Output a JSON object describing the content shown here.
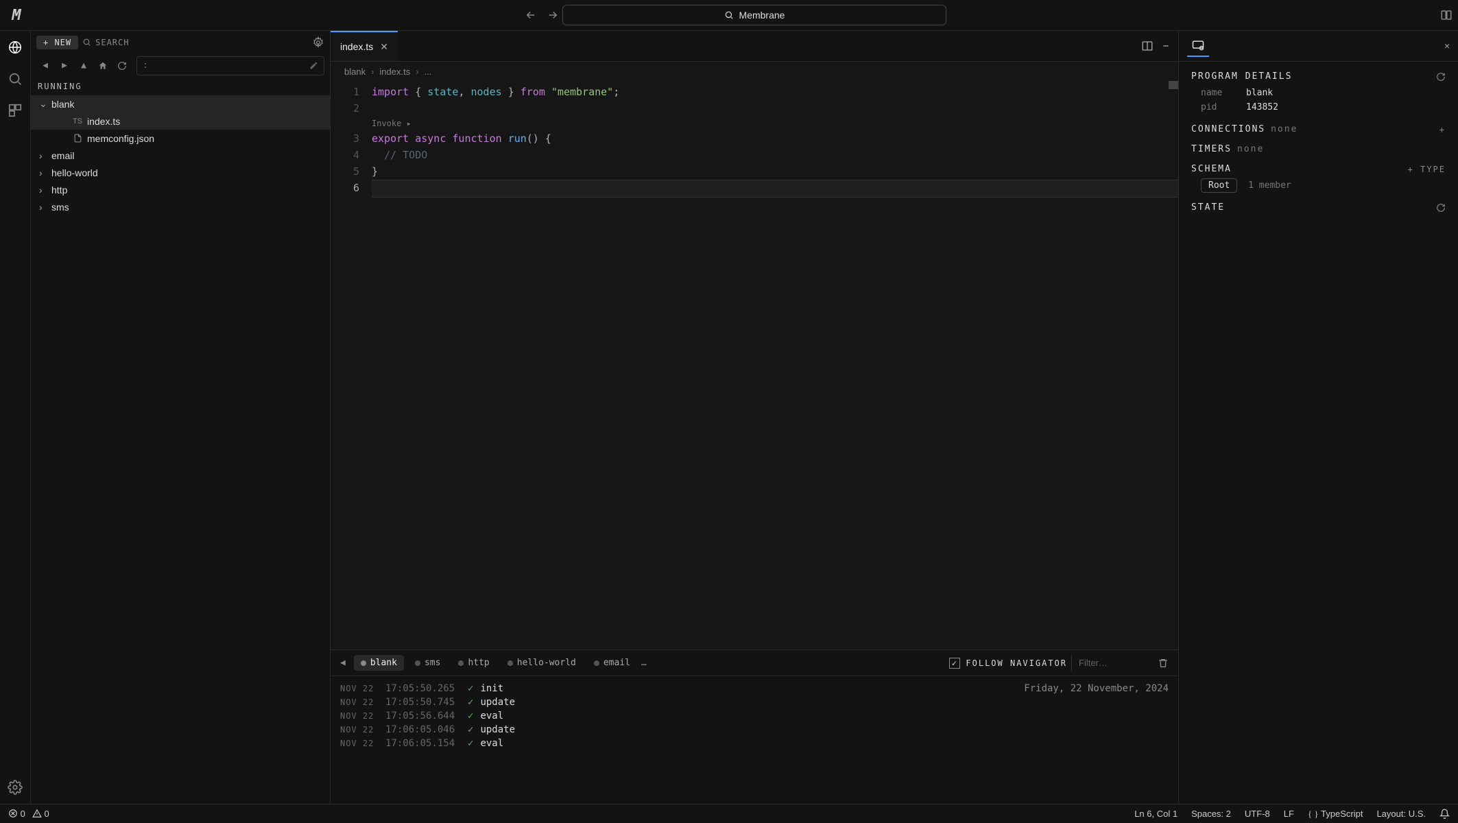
{
  "titlebar": {
    "search_text": "Membrane"
  },
  "sidebar": {
    "new_label": "+ NEW",
    "search_label": "SEARCH",
    "path_prompt": ":",
    "running_label": "RUNNING",
    "tree": {
      "blank": "blank",
      "blank_files": [
        "index.ts",
        "memconfig.json"
      ],
      "folders": [
        "email",
        "hello-world",
        "http",
        "sms"
      ]
    }
  },
  "tab": {
    "name": "index.ts"
  },
  "breadcrumb": {
    "a": "blank",
    "b": "index.ts",
    "c": "..."
  },
  "codelens": "Invoke ▸",
  "code": {
    "l1_import": "import",
    "l1_brace_o": "{",
    "l1_state": "state",
    "l1_comma": ",",
    "l1_nodes": "nodes",
    "l1_brace_c": "}",
    "l1_from": "from",
    "l1_str": "\"membrane\"",
    "l1_semi": ";",
    "l3_export": "export",
    "l3_async": "async",
    "l3_function": "function",
    "l3_run": "run",
    "l3_parens": "()",
    "l3_brace": "{",
    "l4_comment": "// TODO",
    "l5_brace": "}"
  },
  "line_numbers": [
    "1",
    "2",
    "3",
    "4",
    "5",
    "6"
  ],
  "details": {
    "header": "PROGRAM DETAILS",
    "name_k": "name",
    "name_v": "blank",
    "pid_k": "pid",
    "pid_v": "143852",
    "connections": "CONNECTIONS",
    "connections_v": "none",
    "timers": "TIMERS",
    "timers_v": "none",
    "schema": "SCHEMA",
    "add_type": "+ TYPE",
    "root": "Root",
    "root_members": "1 member",
    "state": "STATE",
    "add_conn": "+"
  },
  "console": {
    "tabs": [
      "blank",
      "sms",
      "http",
      "hello-world",
      "email"
    ],
    "follow": "FOLLOW NAVIGATOR",
    "filter_placeholder": "Filter…",
    "date_header": "Friday, 22 November, 2024",
    "rows": [
      {
        "d": "NOV 22",
        "t": "17:05:50.265",
        "m": "init"
      },
      {
        "d": "NOV 22",
        "t": "17:05:50.745",
        "m": "update"
      },
      {
        "d": "NOV 22",
        "t": "17:05:56.644",
        "m": "eval"
      },
      {
        "d": "NOV 22",
        "t": "17:06:05.046",
        "m": "update"
      },
      {
        "d": "NOV 22",
        "t": "17:06:05.154",
        "m": "eval"
      }
    ]
  },
  "status": {
    "errors": "0",
    "warnings": "0",
    "lncol": "Ln 6, Col 1",
    "spaces": "Spaces: 2",
    "encoding": "UTF-8",
    "eol": "LF",
    "lang": "TypeScript",
    "layout": "Layout: U.S."
  }
}
